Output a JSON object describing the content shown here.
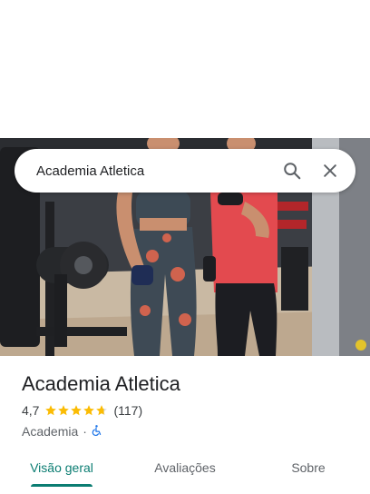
{
  "search": {
    "query": "Academia Atletica",
    "search_icon": "search-icon",
    "close_icon": "close-icon"
  },
  "place": {
    "name": "Academia Atletica",
    "rating": "4,7",
    "stars_value": 4.7,
    "reviews": "(117)",
    "category": "Academia",
    "separator": "·",
    "accessibility_icon": "wheelchair-icon"
  },
  "tabs": [
    {
      "label": "Visão geral",
      "active": true
    },
    {
      "label": "Avaliações",
      "active": false
    },
    {
      "label": "Sobre",
      "active": false
    }
  ],
  "colors": {
    "accent": "#0b7d72",
    "star": "#fbbc04",
    "accessibility": "#1a73e8"
  }
}
